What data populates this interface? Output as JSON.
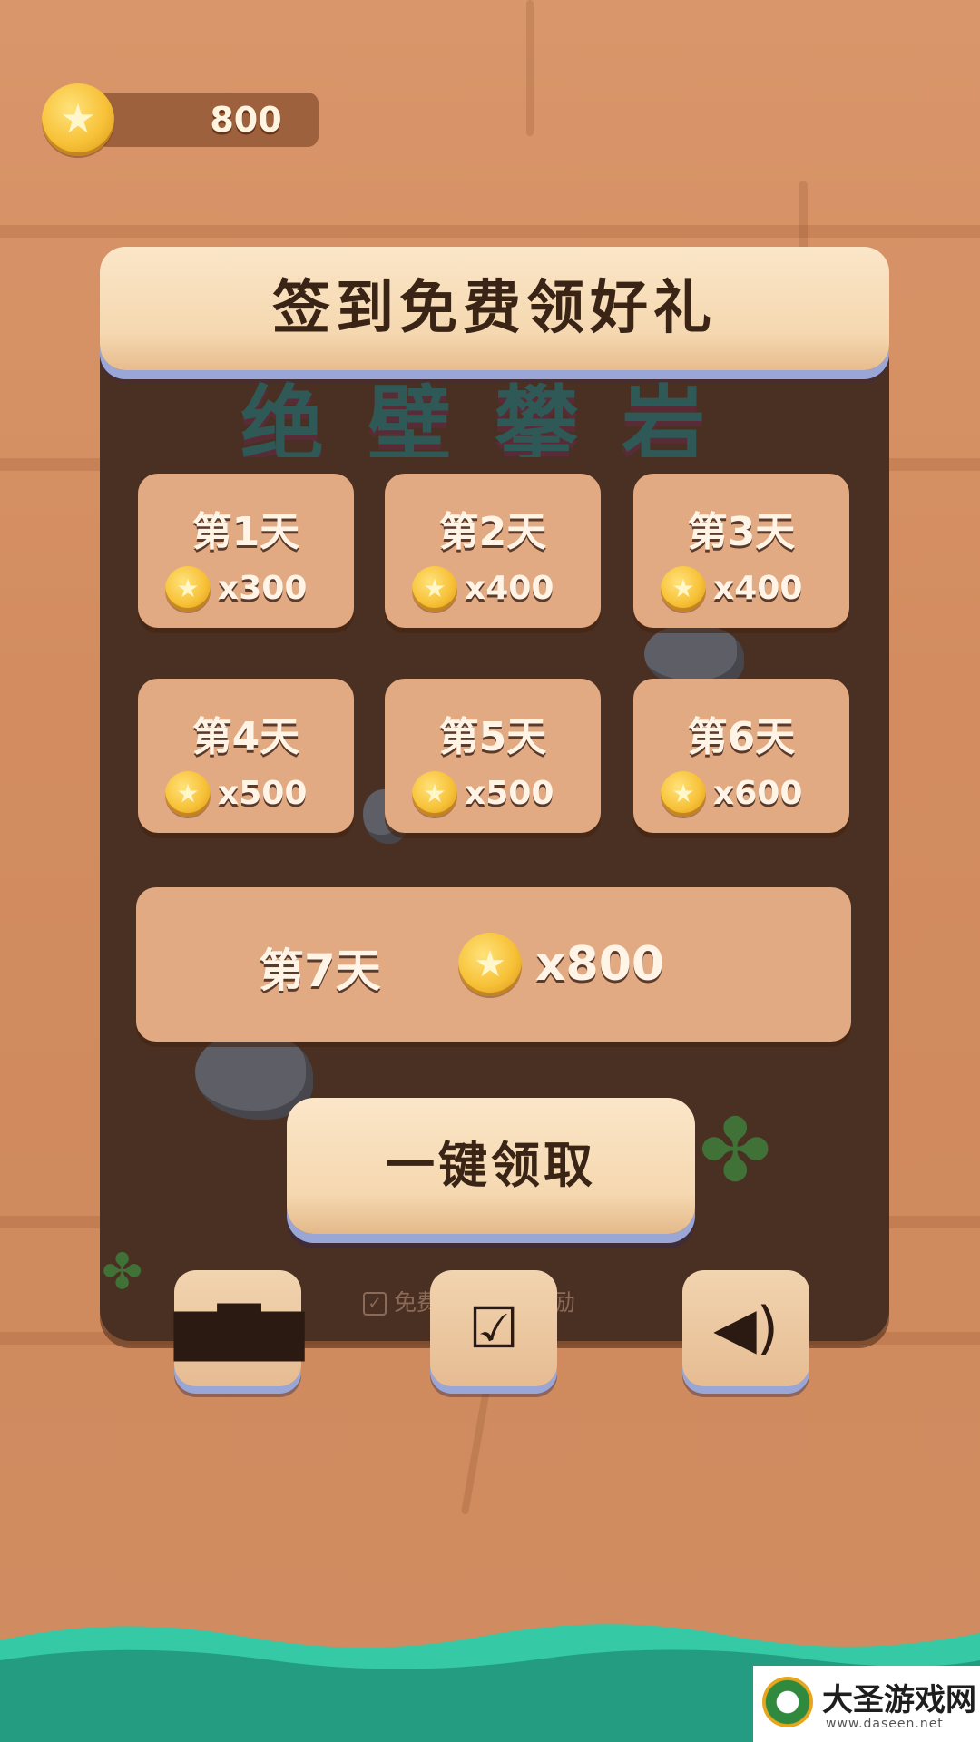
{
  "coin_counter": {
    "value": "800",
    "icon": "star-coin-icon"
  },
  "title": "签到免费领好礼",
  "background_title": "绝壁攀岩",
  "days": [
    {
      "day": "第1天",
      "reward": "x300"
    },
    {
      "day": "第2天",
      "reward": "x400"
    },
    {
      "day": "第3天",
      "reward": "x400"
    },
    {
      "day": "第4天",
      "reward": "x500"
    },
    {
      "day": "第5天",
      "reward": "x500"
    },
    {
      "day": "第6天",
      "reward": "x600"
    },
    {
      "day": "第7天",
      "reward": "x800"
    }
  ],
  "claim_button": {
    "label": "一键领取"
  },
  "double_reward": {
    "label": "免费获得双倍奖励",
    "checked": true
  },
  "bottom_buttons": [
    {
      "name": "leaderboard",
      "icon": "bar-chart-icon"
    },
    {
      "name": "check-in",
      "icon": "calendar-check-icon"
    },
    {
      "name": "sound",
      "icon": "speaker-icon"
    }
  ],
  "watermark": {
    "name": "大圣游戏网",
    "url": "www.daseen.net"
  },
  "colors": {
    "background": "#d28c5f",
    "panel": "#4a3022",
    "card": "#e2aa82",
    "banner": "#f5d8b0",
    "water": "#2fb99a"
  }
}
